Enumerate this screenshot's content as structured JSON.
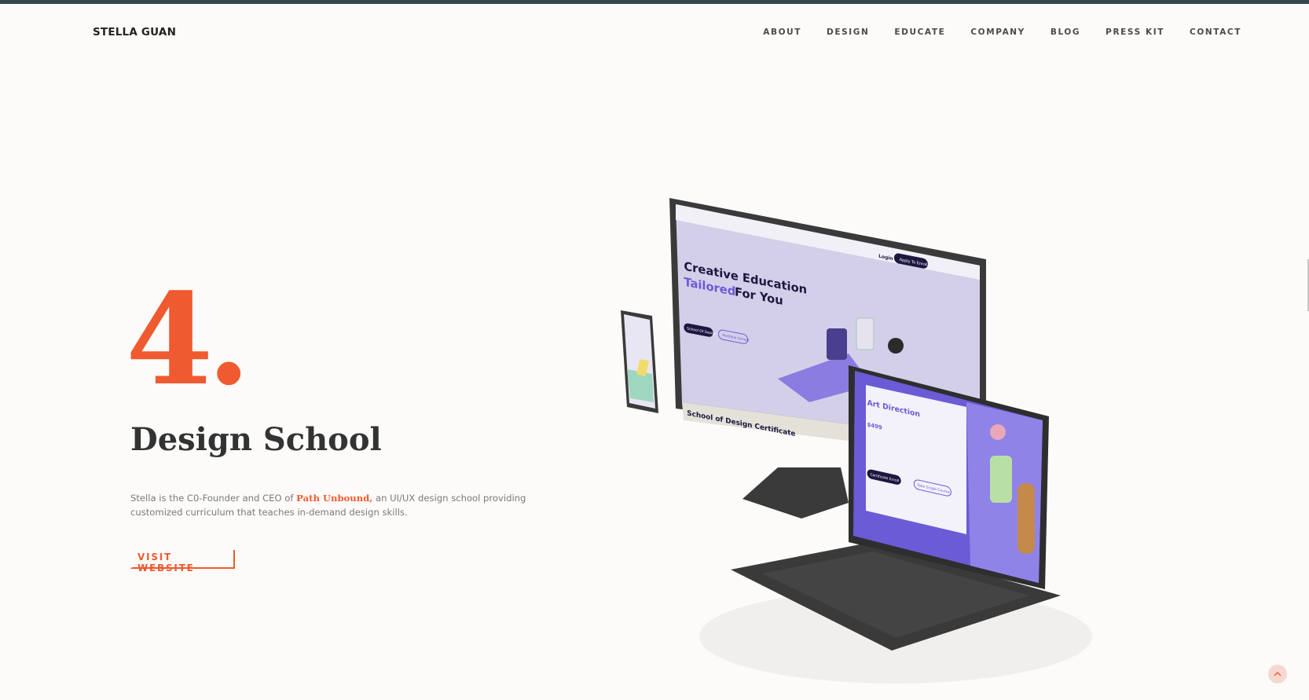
{
  "brand": "STELLA GUAN",
  "nav": [
    "ABOUT",
    "DESIGN",
    "EDUCATE",
    "COMPANY",
    "BLOG",
    "PRESS KIT",
    "CONTACT"
  ],
  "section": {
    "number": "4.",
    "title": "Design School",
    "desc_before": "Stella is the C0-Founder and CEO of ",
    "desc_link": "Path Unbound,",
    "desc_after": " an UI/UX design school providing customized curriculum that teaches in-demand design skills.",
    "cta": "VISIT WEBSITE"
  },
  "mockup": {
    "desktop_headline_1": "Creative Education",
    "desktop_headline_2a": "Tailored",
    "desktop_headline_2b": "For You",
    "desktop_login": "Login",
    "desktop_apply": "Apply To Enroll",
    "desktop_btn_1": "School Of Design",
    "desktop_btn_2": "Portfolio School",
    "desktop_footer": "School of Design Certificate",
    "laptop_heading": "Art Direction",
    "laptop_price": "$499",
    "laptop_btn_1": "Certificate Enroll",
    "laptop_btn_2": "Take Single Course"
  },
  "icons": {
    "back_to_top": "chevron-up-icon"
  },
  "colors": {
    "accent": "#ef5a30",
    "topbar": "#37474f",
    "purple": "#6b5bd6",
    "device": "#3a3a3a"
  }
}
